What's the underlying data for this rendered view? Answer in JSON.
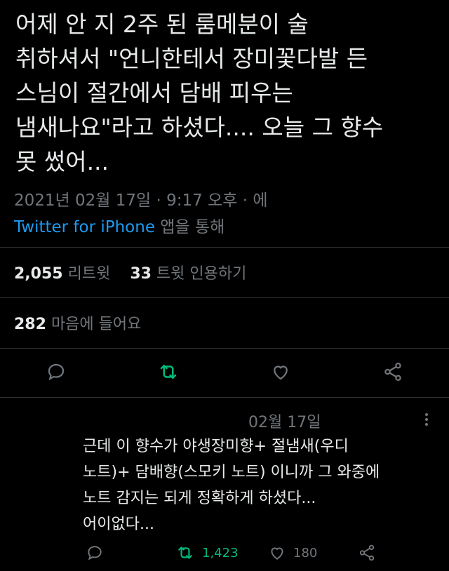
{
  "tweet": {
    "text": "어제 안 지 2주 된 룸메분이 술\n취하셔서 \"언니한테서 장미꽃다발 든\n스님이 절간에서 담배 피우는\n냄새나요\"라고 하셨다.... 오늘 그 향수\n못 썼어...",
    "timestamp": "2021년 02월 17일 · 9:17 오후 · 에",
    "source_app": "Twitter for iPhone",
    "source_suffix": " 앱을 통해"
  },
  "stats": {
    "retweets_count": "2,055",
    "retweets_label": "리트윗",
    "quotes_count": "33",
    "quotes_label": "트윗 인용하기",
    "likes_count": "282",
    "likes_label": "마음에 들어요"
  },
  "actions": {
    "reply_icon": "reply-icon",
    "retweet_icon": "retweet-icon",
    "like_icon": "heart-icon",
    "share_icon": "share-icon",
    "retweet_color": "#00ba7c"
  },
  "reply": {
    "date": "02월 17일",
    "text": "근데 이 향수가 야생장미향+ 절냄새(우디\n노트)+ 담배향(스모키 노트) 이니까 그 와중에\n노트 감지는 되게 정확하게 하셨다...\n어이없다...",
    "retweet_count": "1,423",
    "like_count": "180"
  }
}
